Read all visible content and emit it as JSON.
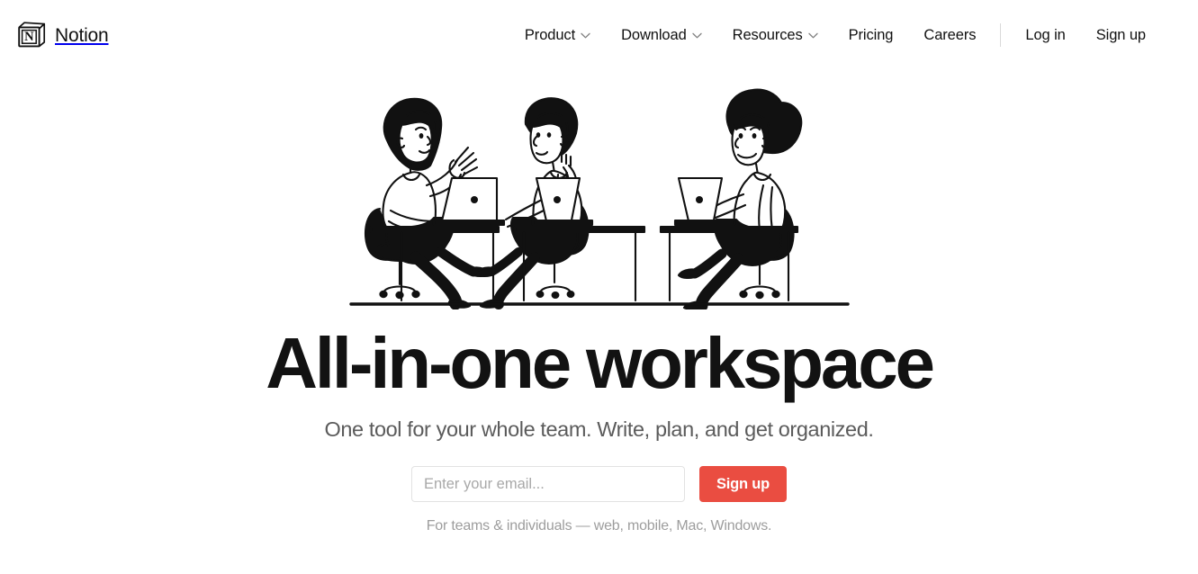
{
  "header": {
    "brand": {
      "logo_icon": "notion-cube-icon",
      "name": "Notion"
    },
    "nav": [
      {
        "label": "Product",
        "has_dropdown": true,
        "icon": "chevron-down-icon"
      },
      {
        "label": "Download",
        "has_dropdown": true,
        "icon": "chevron-down-icon"
      },
      {
        "label": "Resources",
        "has_dropdown": true,
        "icon": "chevron-down-icon"
      },
      {
        "label": "Pricing",
        "has_dropdown": false,
        "icon": ""
      },
      {
        "label": "Careers",
        "has_dropdown": false,
        "icon": ""
      }
    ],
    "auth": [
      {
        "label": "Log in"
      },
      {
        "label": "Sign up"
      }
    ]
  },
  "hero": {
    "illustration_name": "three-people-at-desks-with-laptops-illustration",
    "headline": "All-in-one workspace",
    "subhead": "One tool for your whole team. Write, plan, and get organized.",
    "signup": {
      "email_placeholder": "Enter your email...",
      "email_value": "",
      "button_label": "Sign up"
    },
    "fineprint": "For teams & individuals — web, mobile, Mac, Windows."
  },
  "colors": {
    "accent_red": "#ea4d41",
    "text_primary": "#121212",
    "text_secondary": "#5b5b5b",
    "text_muted": "#9d9d9d",
    "border": "#e2e2e2",
    "background": "#ffffff"
  }
}
